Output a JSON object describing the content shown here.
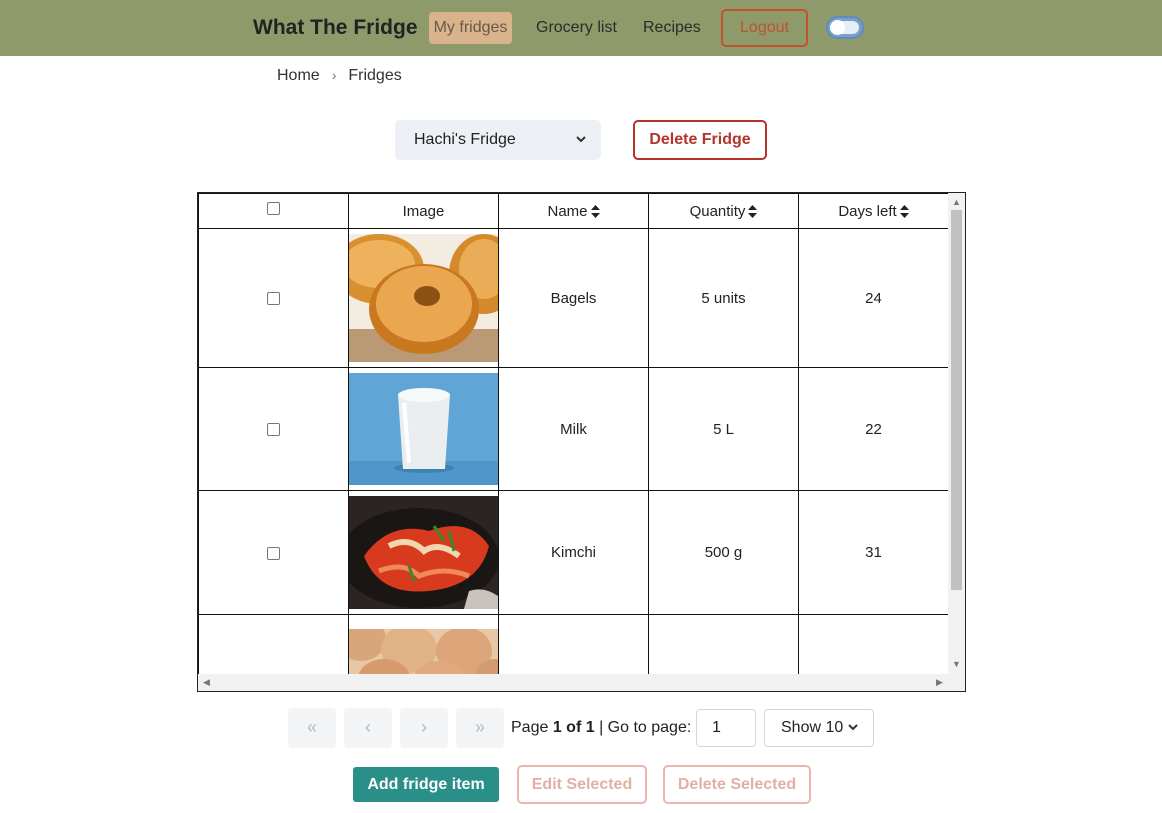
{
  "navbar": {
    "brand": "What The Fridge",
    "links": [
      {
        "label": "My fridges",
        "active": true
      },
      {
        "label": "Grocery list",
        "active": false
      },
      {
        "label": "Recipes",
        "active": false
      }
    ],
    "logout_label": "Logout",
    "theme_toggle_on": false
  },
  "breadcrumb": {
    "items": [
      "Home",
      "Fridges"
    ],
    "separator": "›"
  },
  "fridge_select": {
    "selected": "Hachi's Fridge"
  },
  "delete_fridge_label": "Delete Fridge",
  "table": {
    "headers": {
      "image": "Image",
      "name": "Name",
      "quantity": "Quantity",
      "days_left": "Days left"
    },
    "rows": [
      {
        "name": "Bagels",
        "quantity": "5 units",
        "days_left": "24",
        "image": "bagels"
      },
      {
        "name": "Milk",
        "quantity": "5 L",
        "days_left": "22",
        "image": "milk"
      },
      {
        "name": "Kimchi",
        "quantity": "500 g",
        "days_left": "31",
        "image": "kimchi"
      },
      {
        "name": "",
        "quantity": "",
        "days_left": "",
        "image": "eggs"
      }
    ]
  },
  "pagination": {
    "first": "«",
    "prev": "‹",
    "next": "›",
    "last": "»",
    "page_label": "Page",
    "page_value": "1 of 1",
    "goto_label": "| Go to page:",
    "goto_value": "1",
    "page_size_label": "Show 10"
  },
  "actions": {
    "add_label": "Add fridge item",
    "edit_label": "Edit Selected",
    "delete_label": "Delete Selected"
  },
  "colors": {
    "navbar": "#8f9a6a",
    "active_link": "#d9b38c",
    "logout": "#c0522e",
    "delete": "#b5332a",
    "primary": "#2a8f88"
  }
}
